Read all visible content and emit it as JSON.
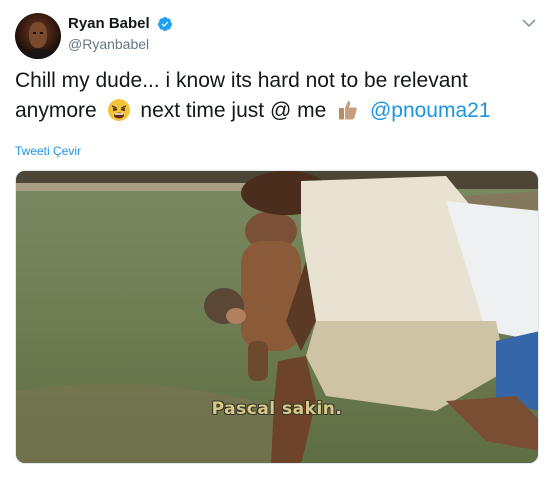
{
  "tweet": {
    "display_name": "Ryan Babel",
    "handle": "@Ryanbabel",
    "verified": true,
    "avatar_icon": "avatar-photo",
    "text_part1": "Chill my dude... i know its hard not to be relevant anymore",
    "emoji1": "weary-face-emoji",
    "text_part2": "next time just @ me",
    "emoji2": "thumbs-up-emoji",
    "mention": "@pnouma21",
    "translate_label": "Tweeti Çevir",
    "media": {
      "subtitle": "Pascal sakin."
    }
  },
  "colors": {
    "link": "#1b95e0",
    "verified": "#1da1f2",
    "secondary_text": "#657786"
  }
}
